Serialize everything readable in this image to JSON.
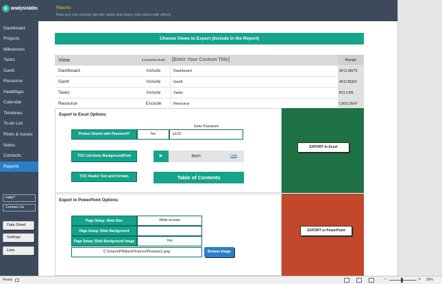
{
  "app": {
    "logo_mark": "a",
    "logo_text": "analysislabs"
  },
  "sidebar": {
    "items": [
      {
        "label": "Dashboard"
      },
      {
        "label": "Projects"
      },
      {
        "label": "Milestones"
      },
      {
        "label": "Tasks"
      },
      {
        "label": "Gantt"
      },
      {
        "label": "Resource"
      },
      {
        "label": "HeatMaps"
      },
      {
        "label": "Calendar"
      },
      {
        "label": "Timelines"
      },
      {
        "label": "To-do List"
      },
      {
        "label": "Risks & Issues"
      },
      {
        "label": "Notes"
      },
      {
        "label": "Contacts"
      },
      {
        "label": "Reports"
      }
    ],
    "help": "Help?",
    "contact": "Contact Us",
    "buttons": {
      "data_sheet": "Data Sheet",
      "settings": "Settings",
      "lists": "Lists"
    }
  },
  "topbar": {
    "title": "Reports:",
    "subtitle": "Now you can choose specific views and share your plans with others"
  },
  "views_section": {
    "header": "Choose Views to Export (Include in the Report)",
    "columns": {
      "view": "View",
      "include": "Include/Exclude",
      "title": "[Enter Your Custom Title]",
      "range": "Range"
    },
    "rows": [
      {
        "view": "Dashboard",
        "include": "Include",
        "title": "Dashboard",
        "range": "AF11:AW70"
      },
      {
        "view": "Gantt",
        "include": "Include",
        "title": "Gantt",
        "range": "AF11:BQ60"
      },
      {
        "view": "Tasks",
        "include": "Include",
        "title": "Tasks",
        "range": "B11:CI66"
      },
      {
        "view": "Resource",
        "include": "Exclude",
        "title": "Resource",
        "range": "CM11:DE47"
      }
    ]
  },
  "excel_section": {
    "title": "Export to Excel Options:",
    "protect_label": "Protect Sheets with Password?",
    "protect_value": "No",
    "password_caption": "Enter Password",
    "password_value": "p123",
    "toc_items_label": "TOC List Items Background/Font Colors",
    "toc_arrow": "▶",
    "toc_item_sample": "Item",
    "toc_link_sample": "Link",
    "toc_header_label": "TOC Header Text and Formats",
    "toc_header_sample": "Table of Contents",
    "export_button": "EXPORT to Excel"
  },
  "ppt_section": {
    "title": "Export to PowerPoint Options:",
    "rows": [
      {
        "label": "Page Setup: Slide Size",
        "value": "Wide-screen"
      },
      {
        "label": "Page Setup: Slide Background",
        "value": ""
      },
      {
        "label": "Page Setup: Slide Background Image",
        "value": "Yes"
      }
    ],
    "image_path": "C:\\Users\\PNRao\\Pictures\\Pictures1.png",
    "browse_button": "Browse Image",
    "export_button": "EXPORT to PowerPoint"
  },
  "statusbar": {
    "ready": "Ready",
    "zoom": "90%",
    "minus": "−",
    "plus": "+"
  },
  "colors": {
    "teal": "#16a38a",
    "excel_panel": "#1f7244",
    "ppt_panel": "#c1482a",
    "sidebar": "#3d4a5c",
    "active": "#2b7fc7"
  }
}
